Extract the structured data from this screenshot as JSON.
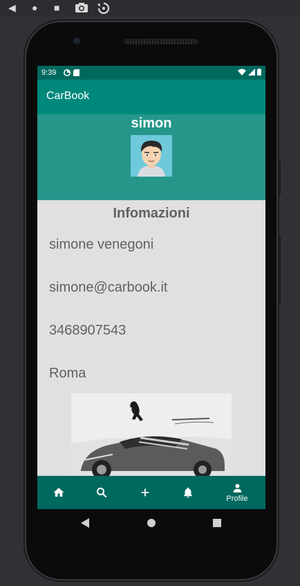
{
  "status_bar": {
    "time": "9:39"
  },
  "app_bar": {
    "title": "CarBook"
  },
  "profile": {
    "username": "simon"
  },
  "info": {
    "title": "Infomazioni",
    "full_name": "simone   venegoni",
    "email": "simone@carbook.it",
    "phone": "3468907543",
    "city": "Roma"
  },
  "bottom_nav": {
    "items": [
      {
        "icon": "home-icon",
        "label": ""
      },
      {
        "icon": "search-icon",
        "label": ""
      },
      {
        "icon": "add-icon",
        "label": ""
      },
      {
        "icon": "bell-icon",
        "label": ""
      },
      {
        "icon": "person-icon",
        "label": "Profile"
      }
    ],
    "selected": "Profile"
  },
  "colors": {
    "primary": "#00897b",
    "primary_dark": "#00695f",
    "header": "#26968a",
    "background": "#e0e0e0",
    "text": "#616161"
  }
}
